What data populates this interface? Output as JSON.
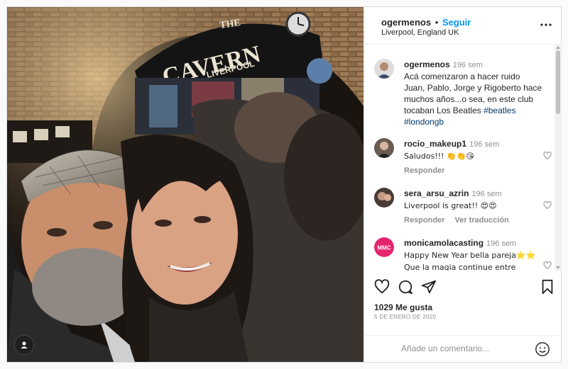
{
  "post": {
    "username": "ogermenos",
    "separator": "•",
    "follow_label": "Seguir",
    "location": "Liverpool, England UK",
    "more_icon": "more-horizontal-icon",
    "photo_sign_line1": "THE",
    "photo_sign_line2": "CAVERN",
    "photo_sign_line3": "LIVERPOOL",
    "caption": {
      "username": "ogermenos",
      "time": "196 sem",
      "text": "Acá comenzaron a hacer ruido Juan, Pablo, Jorge y Rigoberto hace muchos años...o sea, en este club tocaban Los Beatles ",
      "tag1": "#beatles",
      "tag2": "#londongb"
    },
    "comments": [
      {
        "username": "rocio_makeup1",
        "time": "196 sem",
        "text": "Saludos!!! 👏👏😘",
        "reply": "Responder",
        "translate": "",
        "avatar_color": "#6b5b53"
      },
      {
        "username": "sera_arsu_azrin",
        "time": "196 sem",
        "text": "Liverpool is great!! 😍😍",
        "reply": "Responder",
        "translate": "Ver traducción",
        "avatar_color": "#4a3b36"
      },
      {
        "username": "monicamolacasting",
        "time": "196 sem",
        "text": "Happy New Year bella pareja⭐⭐ Que la magia continue entre ustedes🕶✨🕶✨🕶",
        "reply": "",
        "translate": "",
        "avatar_color": "#e6246e",
        "avatar_text": "MMC"
      }
    ],
    "likes": "1029 Me gusta",
    "date": "5 DE ENERO DE 2020",
    "comment_placeholder": "Añade un comentario...",
    "icons": {
      "like": "heart-icon",
      "comment": "comment-icon",
      "share": "send-icon",
      "save": "bookmark-icon",
      "emoji": "emoji-icon",
      "tag": "user-tag-icon"
    }
  }
}
